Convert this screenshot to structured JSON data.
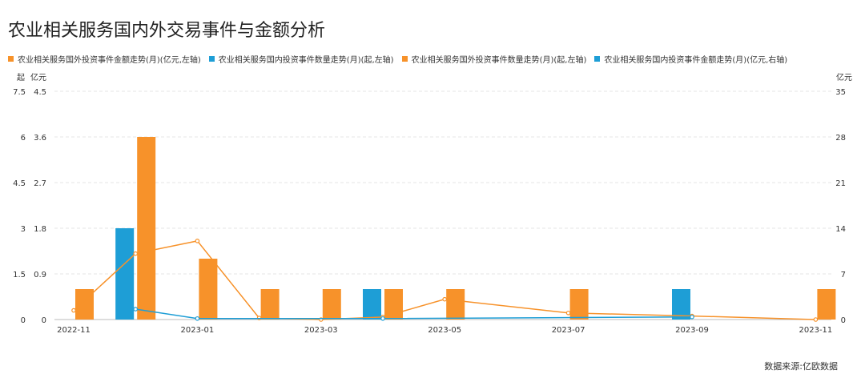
{
  "title": "农业相关服务国内外交易事件与金额分析",
  "source": "数据来源:亿欧数据",
  "colors": {
    "orange": "#F7922A",
    "blue": "#1E9ED6",
    "grid": "#e6e6e6"
  },
  "chart_data": {
    "type": "bar",
    "title": "农业相关服务国内外交易事件与金额分析",
    "x_ticks": [
      "2022-11",
      "2023-01",
      "2023-03",
      "2023-05",
      "2023-07",
      "2023-09",
      "2023-11"
    ],
    "months": [
      "2022-11",
      "2022-12",
      "2023-01",
      "2023-02",
      "2023-03",
      "2023-04",
      "2023-05",
      "2023-06",
      "2023-07",
      "2023-08",
      "2023-09",
      "2023-10",
      "2023-11"
    ],
    "axes": {
      "left_count": {
        "unit": "起",
        "ticks": [
          "7.5",
          "6",
          "4.5",
          "3",
          "1.5",
          "0"
        ],
        "range": [
          0,
          7.5
        ]
      },
      "left_amount": {
        "unit": "亿元",
        "ticks": [
          "4.5",
          "3.6",
          "2.7",
          "1.8",
          "0.9",
          "0"
        ],
        "range": [
          0,
          4.5
        ]
      },
      "right_amount": {
        "unit": "亿元",
        "ticks": [
          "35",
          "28",
          "21",
          "14",
          "7",
          "0"
        ],
        "range": [
          0,
          35
        ]
      }
    },
    "legend": [
      {
        "name": "农业相关服务国外投资事件金额走势(月)(亿元,左轴)",
        "color": "#F7922A"
      },
      {
        "name": "农业相关服务国内投资事件数量走势(月)(起,左轴)",
        "color": "#1E9ED6"
      },
      {
        "name": "农业相关服务国外投资事件数量走势(月)(起,左轴)",
        "color": "#F7922A"
      },
      {
        "name": "农业相关服务国内投资事件金额走势(月)(亿元,右轴)",
        "color": "#1E9ED6"
      }
    ],
    "series": [
      {
        "name": "农业相关服务国内投资事件数量走势(月)(起,左轴)",
        "kind": "bar",
        "axis": "left_count",
        "color": "#1E9ED6",
        "months": [
          "2022-12",
          "2023-04",
          "2023-09"
        ],
        "values": [
          3,
          1,
          1
        ]
      },
      {
        "name": "农业相关服务国外投资事件数量走势(月)(起,左轴)",
        "kind": "bar",
        "axis": "left_count",
        "color": "#F7922A",
        "months": [
          "2022-11",
          "2022-12",
          "2023-01",
          "2023-02",
          "2023-03",
          "2023-04",
          "2023-05",
          "2023-07",
          "2023-11"
        ],
        "values": [
          1,
          6,
          2,
          1,
          1,
          1,
          1,
          1,
          1
        ]
      },
      {
        "name": "农业相关服务国外投资事件金额走势(月)(亿元,左轴)",
        "kind": "line",
        "axis": "left_amount",
        "color": "#F7922A",
        "months": [
          "2022-11",
          "2022-12",
          "2023-01",
          "2023-02",
          "2023-03",
          "2023-04",
          "2023-05",
          "2023-07",
          "2023-09",
          "2023-11"
        ],
        "values": [
          0.18,
          1.3,
          1.55,
          0.03,
          0.0,
          0.05,
          0.4,
          0.13,
          0.07,
          0.0
        ]
      },
      {
        "name": "农业相关服务国内投资事件金额走势(月)(亿元,右轴)",
        "kind": "line",
        "axis": "right_amount",
        "color": "#1E9ED6",
        "months": [
          "2022-12",
          "2023-01",
          "2023-04",
          "2023-09"
        ],
        "values": [
          1.6,
          0.15,
          0.15,
          0.4
        ]
      }
    ]
  }
}
